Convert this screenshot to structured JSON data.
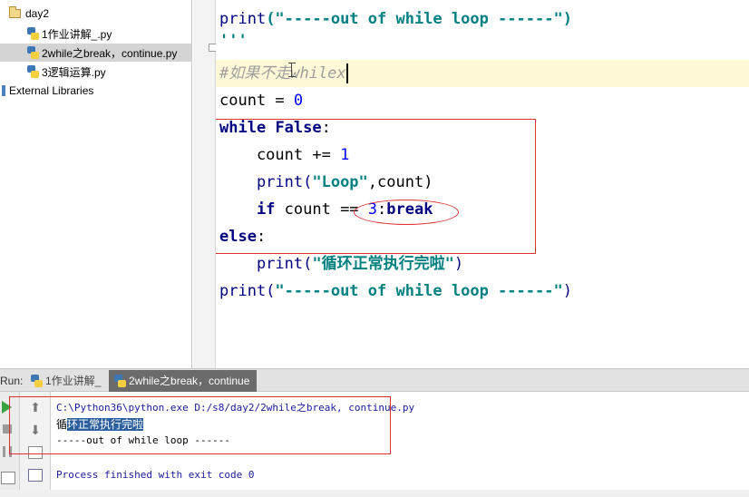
{
  "project_tree": {
    "folder": "day2",
    "files": [
      {
        "name": "1作业讲解_.py",
        "selected": false
      },
      {
        "name": "2while之break，continue.py",
        "selected": true
      },
      {
        "name": "3逻辑运算.py",
        "selected": false
      }
    ],
    "external_libraries": "External Libraries"
  },
  "editor": {
    "lines": {
      "l1_fn": "print",
      "l1_str": "(\"-----out of while loop ------\")",
      "l2": "'''",
      "l3_comment": "#如果不走whilex",
      "l4_text": "count = ",
      "l4_num": "0",
      "l5_kw1": "while",
      "l5_kw2": "False",
      "l5_colon": ":",
      "l6_text": "    count += ",
      "l6_num": "1",
      "l7_fn": "    print(",
      "l7_str": "\"Loop\"",
      "l7_rest": ",count)",
      "l8_kw": "    if",
      "l8_text": " count == ",
      "l8_num": "3",
      "l8_colon": ":",
      "l8_kw2": "break",
      "l9_kw": "else",
      "l9_colon": ":",
      "l10_fn": "    print(",
      "l10_str": "\"循环正常执行完啦\"",
      "l10_close": ")",
      "l11_fn": "print(",
      "l11_str": "\"-----out of while loop ------\"",
      "l11_close": ")"
    }
  },
  "run_panel": {
    "label": "Run:",
    "tabs": [
      {
        "label": "1作业讲解_",
        "active": false
      },
      {
        "label": "2while之break，continue",
        "active": true
      }
    ],
    "console": {
      "command": "C:\\Python36\\python.exe D:/s8/day2/2while之break, continue.py",
      "output_first_char": "循",
      "output_selected": "环正常执行完啦",
      "output_line2": "-----out of while loop ------",
      "exit_message": "Process finished with exit code 0"
    }
  },
  "colors": {
    "keyword": "#000080",
    "string": "#008080",
    "number": "#0000ff",
    "comment": "#9e9e9e",
    "annotation_red": "#e03030",
    "current_line": "#fff9d8",
    "active_tab": "#6b6b6b"
  }
}
